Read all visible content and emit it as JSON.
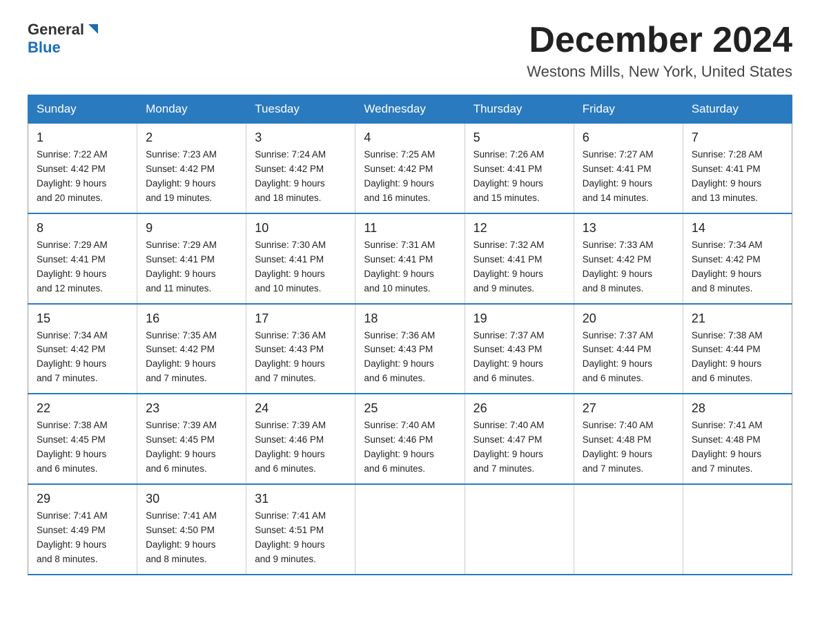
{
  "header": {
    "logo_general": "General",
    "logo_blue": "Blue",
    "month_title": "December 2024",
    "location": "Westons Mills, New York, United States"
  },
  "weekdays": [
    "Sunday",
    "Monday",
    "Tuesday",
    "Wednesday",
    "Thursday",
    "Friday",
    "Saturday"
  ],
  "weeks": [
    [
      {
        "day": "1",
        "sunrise": "7:22 AM",
        "sunset": "4:42 PM",
        "daylight": "9 hours and 20 minutes."
      },
      {
        "day": "2",
        "sunrise": "7:23 AM",
        "sunset": "4:42 PM",
        "daylight": "9 hours and 19 minutes."
      },
      {
        "day": "3",
        "sunrise": "7:24 AM",
        "sunset": "4:42 PM",
        "daylight": "9 hours and 18 minutes."
      },
      {
        "day": "4",
        "sunrise": "7:25 AM",
        "sunset": "4:42 PM",
        "daylight": "9 hours and 16 minutes."
      },
      {
        "day": "5",
        "sunrise": "7:26 AM",
        "sunset": "4:41 PM",
        "daylight": "9 hours and 15 minutes."
      },
      {
        "day": "6",
        "sunrise": "7:27 AM",
        "sunset": "4:41 PM",
        "daylight": "9 hours and 14 minutes."
      },
      {
        "day": "7",
        "sunrise": "7:28 AM",
        "sunset": "4:41 PM",
        "daylight": "9 hours and 13 minutes."
      }
    ],
    [
      {
        "day": "8",
        "sunrise": "7:29 AM",
        "sunset": "4:41 PM",
        "daylight": "9 hours and 12 minutes."
      },
      {
        "day": "9",
        "sunrise": "7:29 AM",
        "sunset": "4:41 PM",
        "daylight": "9 hours and 11 minutes."
      },
      {
        "day": "10",
        "sunrise": "7:30 AM",
        "sunset": "4:41 PM",
        "daylight": "9 hours and 10 minutes."
      },
      {
        "day": "11",
        "sunrise": "7:31 AM",
        "sunset": "4:41 PM",
        "daylight": "9 hours and 10 minutes."
      },
      {
        "day": "12",
        "sunrise": "7:32 AM",
        "sunset": "4:41 PM",
        "daylight": "9 hours and 9 minutes."
      },
      {
        "day": "13",
        "sunrise": "7:33 AM",
        "sunset": "4:42 PM",
        "daylight": "9 hours and 8 minutes."
      },
      {
        "day": "14",
        "sunrise": "7:34 AM",
        "sunset": "4:42 PM",
        "daylight": "9 hours and 8 minutes."
      }
    ],
    [
      {
        "day": "15",
        "sunrise": "7:34 AM",
        "sunset": "4:42 PM",
        "daylight": "9 hours and 7 minutes."
      },
      {
        "day": "16",
        "sunrise": "7:35 AM",
        "sunset": "4:42 PM",
        "daylight": "9 hours and 7 minutes."
      },
      {
        "day": "17",
        "sunrise": "7:36 AM",
        "sunset": "4:43 PM",
        "daylight": "9 hours and 7 minutes."
      },
      {
        "day": "18",
        "sunrise": "7:36 AM",
        "sunset": "4:43 PM",
        "daylight": "9 hours and 6 minutes."
      },
      {
        "day": "19",
        "sunrise": "7:37 AM",
        "sunset": "4:43 PM",
        "daylight": "9 hours and 6 minutes."
      },
      {
        "day": "20",
        "sunrise": "7:37 AM",
        "sunset": "4:44 PM",
        "daylight": "9 hours and 6 minutes."
      },
      {
        "day": "21",
        "sunrise": "7:38 AM",
        "sunset": "4:44 PM",
        "daylight": "9 hours and 6 minutes."
      }
    ],
    [
      {
        "day": "22",
        "sunrise": "7:38 AM",
        "sunset": "4:45 PM",
        "daylight": "9 hours and 6 minutes."
      },
      {
        "day": "23",
        "sunrise": "7:39 AM",
        "sunset": "4:45 PM",
        "daylight": "9 hours and 6 minutes."
      },
      {
        "day": "24",
        "sunrise": "7:39 AM",
        "sunset": "4:46 PM",
        "daylight": "9 hours and 6 minutes."
      },
      {
        "day": "25",
        "sunrise": "7:40 AM",
        "sunset": "4:46 PM",
        "daylight": "9 hours and 6 minutes."
      },
      {
        "day": "26",
        "sunrise": "7:40 AM",
        "sunset": "4:47 PM",
        "daylight": "9 hours and 7 minutes."
      },
      {
        "day": "27",
        "sunrise": "7:40 AM",
        "sunset": "4:48 PM",
        "daylight": "9 hours and 7 minutes."
      },
      {
        "day": "28",
        "sunrise": "7:41 AM",
        "sunset": "4:48 PM",
        "daylight": "9 hours and 7 minutes."
      }
    ],
    [
      {
        "day": "29",
        "sunrise": "7:41 AM",
        "sunset": "4:49 PM",
        "daylight": "9 hours and 8 minutes."
      },
      {
        "day": "30",
        "sunrise": "7:41 AM",
        "sunset": "4:50 PM",
        "daylight": "9 hours and 8 minutes."
      },
      {
        "day": "31",
        "sunrise": "7:41 AM",
        "sunset": "4:51 PM",
        "daylight": "9 hours and 9 minutes."
      },
      null,
      null,
      null,
      null
    ]
  ],
  "labels": {
    "sunrise": "Sunrise:",
    "sunset": "Sunset:",
    "daylight": "Daylight:"
  }
}
